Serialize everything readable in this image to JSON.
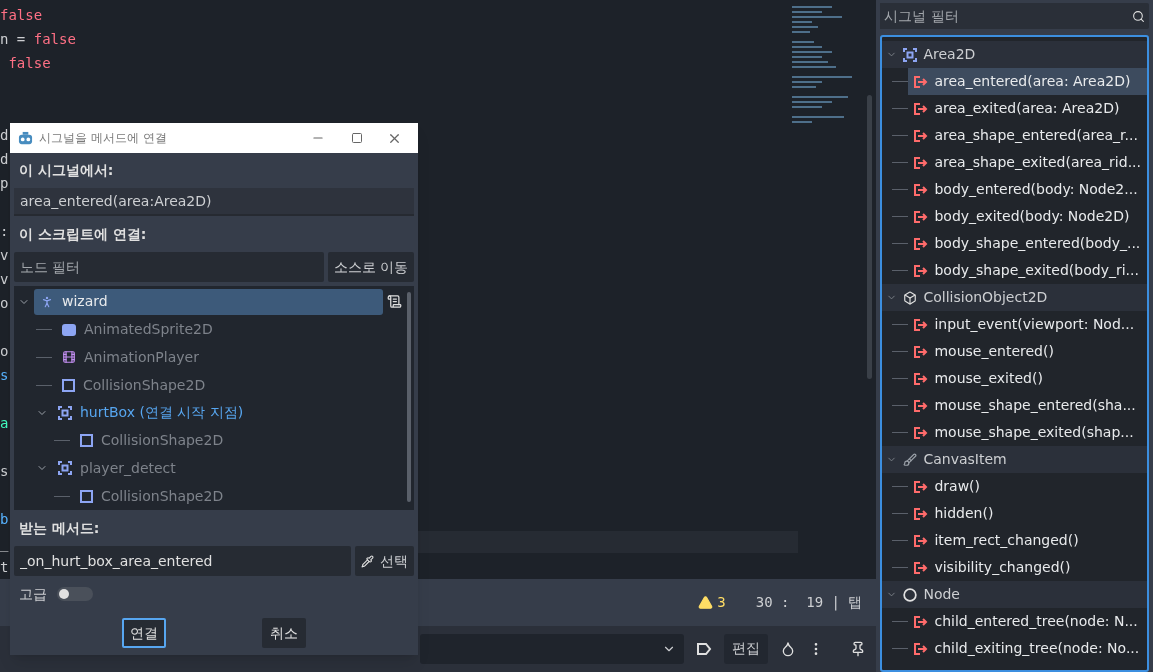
{
  "editor": {
    "lines": [
      {
        "text": "false",
        "kind": "literal"
      },
      {
        "text": "n = false",
        "kind": "assign"
      },
      {
        "text": " false",
        "kind": "literal"
      },
      {
        "kind": "blank"
      },
      {
        "kind": "blank"
      },
      {
        "text": "d",
        "kind": "plain"
      },
      {
        "text": "d",
        "kind": "plain"
      },
      {
        "text": "p",
        "kind": "plain"
      },
      {
        "kind": "blank"
      },
      {
        "text": ":",
        "kind": "plain"
      },
      {
        "text": "v",
        "kind": "plain"
      },
      {
        "text": "v",
        "kind": "plain"
      },
      {
        "text": "o",
        "kind": "plain"
      },
      {
        "kind": "blank"
      },
      {
        "text": "o",
        "kind": "plain"
      },
      {
        "text": "s",
        "kind": "name"
      },
      {
        "kind": "blank"
      },
      {
        "text": "a",
        "kind": "type"
      },
      {
        "kind": "blank"
      },
      {
        "text": "s",
        "kind": "plain"
      },
      {
        "kind": "blank"
      },
      {
        "text": "b",
        "kind": "name"
      },
      {
        "text": "_",
        "kind": "plain"
      },
      {
        "text": "t",
        "kind": "plain"
      }
    ],
    "status": {
      "warnings": "3",
      "position": "30 :  19 | 탭"
    }
  },
  "bottom_bar": {
    "edit_button": "편집"
  },
  "dialog": {
    "title": "시그널을 메서드에 연결",
    "from_label": "이 시그널에서:",
    "signal": "area_entered(area:Area2D)",
    "to_label": "이 스크립트에 연결:",
    "filter": {
      "placeholder": "노드 필터"
    },
    "go_to_source": "소스로 이동",
    "tree": [
      {
        "name": "wizard",
        "kind": "character",
        "selected": true,
        "disabled": false,
        "source": false,
        "expanded": true,
        "script": true,
        "children": [
          {
            "name": "AnimatedSprite2D",
            "kind": "sprite",
            "selected": false,
            "disabled": true,
            "source": false
          },
          {
            "name": "AnimationPlayer",
            "kind": "film",
            "selected": false,
            "disabled": true,
            "source": false
          },
          {
            "name": "CollisionShape2D",
            "kind": "shape",
            "selected": false,
            "disabled": true,
            "source": false
          },
          {
            "name": "hurtBox (연결 시작 지점)",
            "kind": "area",
            "selected": false,
            "disabled": false,
            "source": true,
            "expanded": true,
            "children": [
              {
                "name": "CollisionShape2D",
                "kind": "shape",
                "selected": false,
                "disabled": true,
                "source": false
              }
            ]
          },
          {
            "name": "player_detect",
            "kind": "area",
            "selected": false,
            "disabled": true,
            "source": false,
            "expanded": true,
            "children": [
              {
                "name": "CollisionShape2D",
                "kind": "shape",
                "selected": false,
                "disabled": true,
                "source": false
              }
            ]
          }
        ]
      }
    ],
    "method_label": "받는 메서드:",
    "method": "_on_hurt_box_area_entered",
    "pick_button": "선택",
    "advanced": {
      "label": "고급",
      "on": false
    },
    "buttons": [
      {
        "label": "연결",
        "focused": true
      },
      {
        "label": "취소",
        "focused": false
      }
    ]
  },
  "signals_panel": {
    "filter": {
      "placeholder": "시그널 필터"
    },
    "groups": [
      {
        "name": "Area2D",
        "kind": "area",
        "expanded": true,
        "signals": [
          {
            "name": "area_entered(area: Area2D)",
            "selected": true
          },
          {
            "name": "area_exited(area: Area2D)",
            "selected": false
          },
          {
            "name": "area_shape_entered(area_r...",
            "selected": false
          },
          {
            "name": "area_shape_exited(area_rid...",
            "selected": false
          },
          {
            "name": "body_entered(body: Node2...",
            "selected": false
          },
          {
            "name": "body_exited(body: Node2D)",
            "selected": false
          },
          {
            "name": "body_shape_entered(body_...",
            "selected": false
          },
          {
            "name": "body_shape_exited(body_ri...",
            "selected": false
          }
        ]
      },
      {
        "name": "CollisionObject2D",
        "kind": "cube",
        "expanded": true,
        "signals": [
          {
            "name": "input_event(viewport: Nod...",
            "selected": false
          },
          {
            "name": "mouse_entered()",
            "selected": false
          },
          {
            "name": "mouse_exited()",
            "selected": false
          },
          {
            "name": "mouse_shape_entered(sha...",
            "selected": false
          },
          {
            "name": "mouse_shape_exited(shap...",
            "selected": false
          }
        ]
      },
      {
        "name": "CanvasItem",
        "kind": "brush",
        "expanded": true,
        "signals": [
          {
            "name": "draw()",
            "selected": false
          },
          {
            "name": "hidden()",
            "selected": false
          },
          {
            "name": "item_rect_changed()",
            "selected": false
          },
          {
            "name": "visibility_changed()",
            "selected": false
          }
        ]
      },
      {
        "name": "Node",
        "kind": "circle",
        "expanded": true,
        "signals": [
          {
            "name": "child_entered_tree(node: N...",
            "selected": false
          },
          {
            "name": "child_exiting_tree(node: No...",
            "selected": false
          }
        ]
      }
    ]
  }
}
